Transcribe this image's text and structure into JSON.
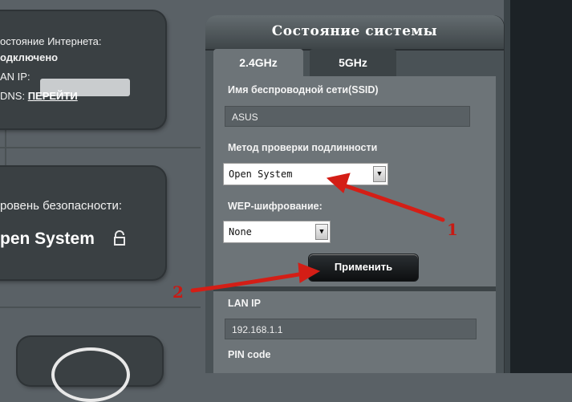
{
  "internet_card": {
    "status_label": "остояние Интернета:",
    "status_value": "одключено",
    "lan_ip_label": "AN IP:",
    "dns_label": "DNS:",
    "dns_link": "ПЕРЕЙТИ"
  },
  "security_card": {
    "title": "ровень безопасности:",
    "value": "pen System"
  },
  "panel": {
    "title": "Состояние системы",
    "tabs": [
      {
        "label": "2.4GHz"
      },
      {
        "label": "5GHz"
      }
    ],
    "ssid_label": "Имя беспроводной сети(SSID)",
    "ssid_value": "ASUS",
    "auth_label": "Метод проверки подлинности",
    "auth_value": "Open System",
    "wep_label": "WEP-шифрование:",
    "wep_value": "None",
    "apply_label": "Применить",
    "lan_ip_label": "LAN IP",
    "lan_ip_value": "192.168.1.1",
    "pin_label": "PIN code"
  },
  "annotations": {
    "num1": "1",
    "num2": "2",
    "arrow_color": "#d41e16"
  },
  "icons": {
    "lock": "lock-icon",
    "dropdown": "chevron-down-icon"
  }
}
